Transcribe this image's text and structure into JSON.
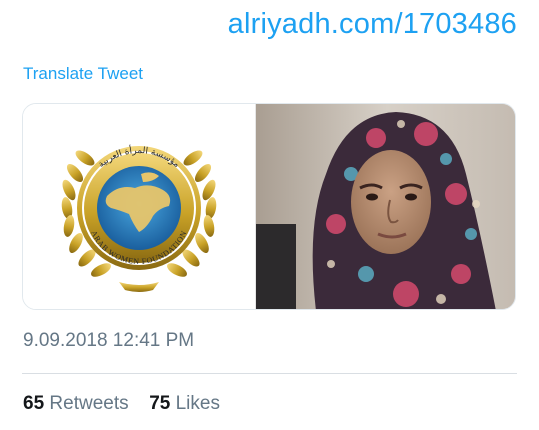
{
  "tweet": {
    "link_text": "alriyadh.com/1703486",
    "translate_label": "Translate Tweet",
    "timestamp": "9.09.2018 12:41 PM"
  },
  "media": {
    "left_image": {
      "description_icon": "arab-women-foundation-logo",
      "logo_text_top": "مؤسسة المرأة العربية",
      "logo_text_bottom": "ARAB WOMEN FOUNDATION"
    },
    "right_image": {
      "description_icon": "portrait-photo"
    }
  },
  "stats": {
    "retweets_count": "65",
    "retweets_label": "Retweets",
    "likes_count": "75",
    "likes_label": "Likes"
  },
  "colors": {
    "link": "#1da1f2",
    "muted": "#657786",
    "text": "#14171a",
    "gold": "#c9a227",
    "globe_blue": "#1f7fc4"
  }
}
